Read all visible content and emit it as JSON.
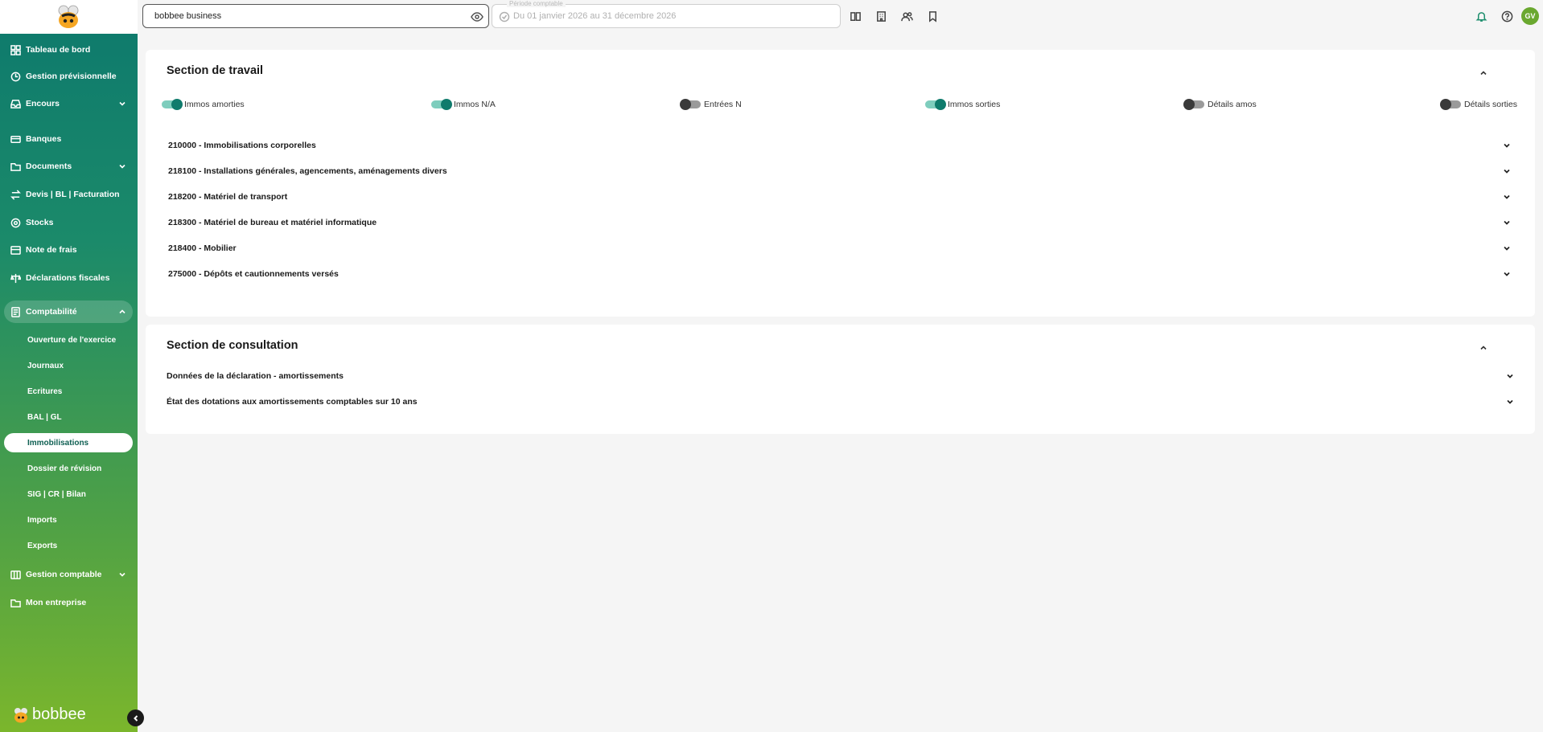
{
  "sidebar": {
    "items": [
      {
        "label": "Tableau de bord",
        "icon": "dashboard-icon"
      },
      {
        "label": "Gestion prévisionnelle",
        "icon": "forecast-icon"
      },
      {
        "label": "Encours",
        "icon": "inbox-icon"
      },
      {
        "label": "Banques",
        "icon": "bank-icon"
      },
      {
        "label": "Documents",
        "icon": "document-icon"
      },
      {
        "label": "Devis | BL | Facturation",
        "icon": "exchange-icon"
      },
      {
        "label": "Stocks",
        "icon": "stock-icon"
      },
      {
        "label": "Note de frais",
        "icon": "receipt-icon"
      },
      {
        "label": "Déclarations fiscales",
        "icon": "tax-icon"
      },
      {
        "label": "Comptabilité",
        "icon": "accounting-icon"
      },
      {
        "label": "Gestion comptable",
        "icon": "ledger-icon"
      },
      {
        "label": "Mon entreprise",
        "icon": "folder-icon"
      }
    ],
    "sub_items": [
      {
        "label": "Ouverture de l'exercice"
      },
      {
        "label": "Journaux"
      },
      {
        "label": "Ecritures"
      },
      {
        "label": "BAL | GL"
      },
      {
        "label": "Immobilisations"
      },
      {
        "label": "Dossier de révision"
      },
      {
        "label": "SIG | CR | Bilan"
      },
      {
        "label": "Imports"
      },
      {
        "label": "Exports"
      }
    ],
    "brand": "bobbee"
  },
  "topbar": {
    "company": "bobbee business",
    "period_label": "Période comptable",
    "period_value": "Du 01 janvier 2026 au 31 décembre 2026",
    "avatar": "GV"
  },
  "work_section": {
    "title": "Section de travail",
    "toggles": [
      {
        "label": "Immos amorties",
        "on": true
      },
      {
        "label": "Immos N/A",
        "on": true
      },
      {
        "label": "Entrées N",
        "on": false
      },
      {
        "label": "Immos sorties",
        "on": true
      },
      {
        "label": "Détails amos",
        "on": false
      },
      {
        "label": "Détails sorties",
        "on": false
      }
    ],
    "accounts": [
      {
        "label": "210000 - Immobilisations corporelles"
      },
      {
        "label": "218100 - Installations générales, agencements, aménagements divers"
      },
      {
        "label": "218200 - Matériel de transport"
      },
      {
        "label": "218300 - Matériel de bureau et matériel informatique"
      },
      {
        "label": "218400 - Mobilier"
      },
      {
        "label": "275000 - Dépôts et cautionnements versés"
      }
    ]
  },
  "consult_section": {
    "title": "Section de consultation",
    "rows": [
      {
        "label": "Données de la déclaration - amortissements"
      },
      {
        "label": "État des dotations aux amortissements comptables sur 10 ans"
      }
    ]
  },
  "colors": {
    "accent": "#0f7b6c",
    "sidebar_bottom": "#7bb62c"
  }
}
